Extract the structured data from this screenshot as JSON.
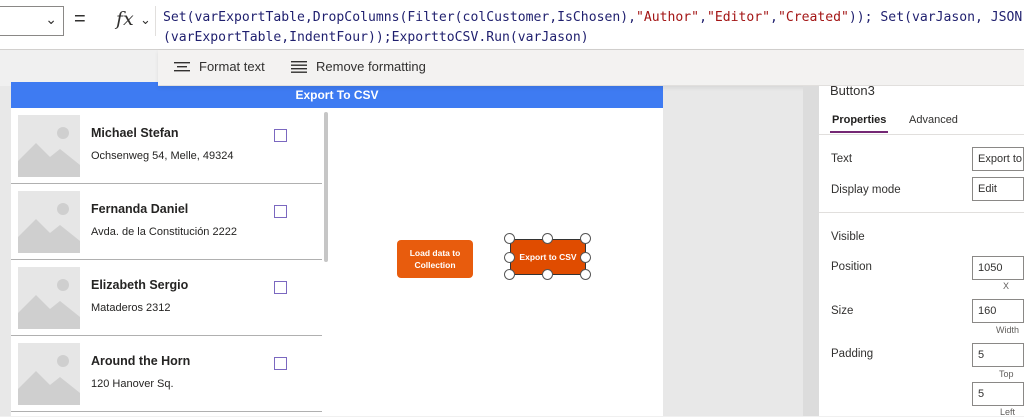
{
  "formula_bar": {
    "equals": "=",
    "fx": "fx",
    "line1": [
      {
        "t": "Set(varExportTable,DropColumns(Filter(colCustomer,IsChosen),",
        "k": "code"
      },
      {
        "t": "\"Author\"",
        "k": "str"
      },
      {
        "t": ",",
        "k": "code"
      },
      {
        "t": "\"Editor\"",
        "k": "str"
      },
      {
        "t": ",",
        "k": "code"
      },
      {
        "t": "\"Created\"",
        "k": "str"
      },
      {
        "t": ")); Set(varJason, JSON",
        "k": "code"
      }
    ],
    "line2": "(varExportTable,IndentFour));ExporttoCSV.Run(varJason)"
  },
  "toolbar": {
    "format_text": "Format text",
    "remove_formatting": "Remove formatting"
  },
  "screen": {
    "header": "Export To CSV",
    "gallery": [
      {
        "title": "Michael Stefan",
        "subtitle": "Ochsenweg 54, Melle, 49324"
      },
      {
        "title": "Fernanda Daniel",
        "subtitle": "Avda. de la Constitución 2222"
      },
      {
        "title": "Elizabeth Sergio",
        "subtitle": "Mataderos 2312"
      },
      {
        "title": "Around the Horn",
        "subtitle": "120 Hanover Sq."
      }
    ],
    "load_button": "Load data to Collection",
    "export_button": "Export to CSV"
  },
  "properties": {
    "control_name": "Button3",
    "tabs": [
      "Properties",
      "Advanced"
    ],
    "text_label": "Text",
    "text_value": "Export to CSV",
    "display_mode_label": "Display mode",
    "display_mode_value": "Edit",
    "visible_label": "Visible",
    "position_label": "Position",
    "position_x": "1050",
    "position_x_caption": "X",
    "size_label": "Size",
    "size_width": "160",
    "size_width_caption": "Width",
    "padding_label": "Padding",
    "padding_top": "5",
    "padding_top_caption": "Top",
    "padding_left": "5",
    "padding_left_caption": "Left"
  },
  "colors": {
    "header_blue": "#3e7bf2",
    "button_orange": "#e85c0d",
    "tab_accent": "#742774"
  }
}
